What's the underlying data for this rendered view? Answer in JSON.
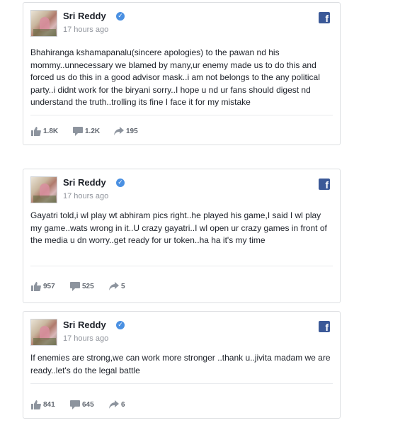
{
  "posts": [
    {
      "author": "Sri Reddy",
      "time": "17 hours ago",
      "text": "Bhahiranga kshamapanalu(sincere apologies) to the pawan nd his mommy..unnecessary we blamed by many,ur enemy made us to do this and forced us do this in a good advisor mask..i am not belongs to the any political party..i didnt work for the biryani sorry..I hope u nd ur fans should digest nd understand the truth..trolling its fine I face it for my mistake",
      "likes": "1.8K",
      "comments": "1.2K",
      "shares": "195"
    },
    {
      "author": "Sri Reddy",
      "time": "17 hours ago",
      "text": "Gayatri told,i wl play wt abhiram pics right..he played his game,I said I wl play my game..wats wrong in it..U crazy gayatri..I wl open ur crazy games in front of the media u dn worry..get ready for ur token..ha ha it's my time",
      "likes": "957",
      "comments": "525",
      "shares": "5"
    },
    {
      "author": "Sri Reddy",
      "time": "17 hours ago",
      "text": "If enemies are strong,we can work more stronger ..thank u..jivita madam we are ready..let's do the legal battle",
      "likes": "841",
      "comments": "645",
      "shares": "6"
    }
  ],
  "icons": {
    "verified": "verified-badge-icon",
    "platform": "facebook-icon",
    "like": "thumbs-up-icon",
    "comment": "comment-icon",
    "share": "share-arrow-icon",
    "brand_color": "#3b5998",
    "verified_color": "#4a90e2"
  }
}
